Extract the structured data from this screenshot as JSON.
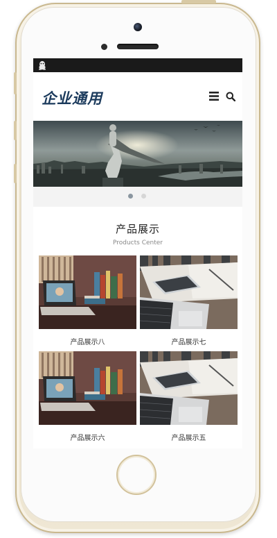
{
  "header": {
    "logo_text": "企业通用"
  },
  "icons": {
    "status": "qq-penguin-icon",
    "menu": "hamburger-menu-icon",
    "search": "search-icon"
  },
  "carousel": {
    "slide_count": 2,
    "active_index": 0,
    "colors": {
      "active": "#8a96a0",
      "inactive": "#d6d6d6"
    }
  },
  "products": {
    "title": "产品展示",
    "subtitle": "Products Center",
    "items": [
      {
        "label": "产品展示八",
        "image": "laptop-desk-photo"
      },
      {
        "label": "产品展示七",
        "image": "phone-notebook-photo"
      },
      {
        "label": "产品展示六",
        "image": "laptop-desk-photo"
      },
      {
        "label": "产品展示五",
        "image": "phone-notebook-photo"
      }
    ]
  },
  "colors": {
    "status_bar": "#1a1a1a",
    "logo": "#1b3a5c",
    "page_bg": "#f5f5f5",
    "phone_frame": "#e7dcc2"
  }
}
